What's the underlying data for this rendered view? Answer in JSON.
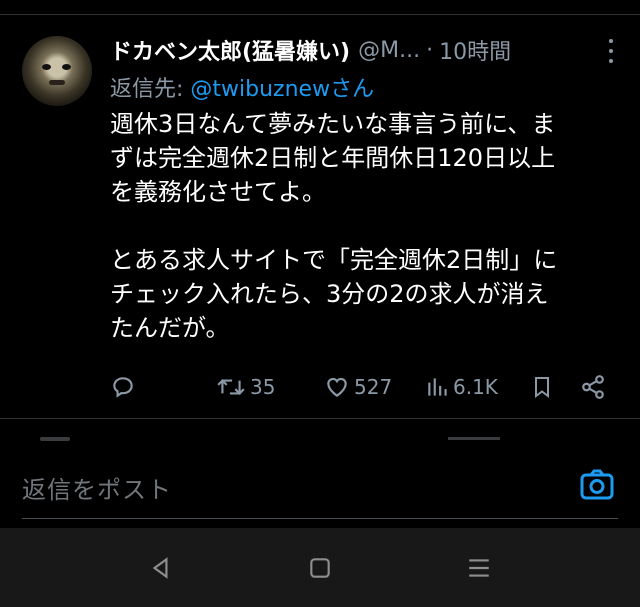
{
  "tweet": {
    "author_name": "ドカベン太郎(猛暑嫌い)",
    "author_handle": "@M...",
    "separator": "·",
    "time": "10時間",
    "reply_prefix": "返信先: ",
    "reply_mention": "@twibuznewさん",
    "body_lines": [
      "週休3日なんて夢みたいな事言う前に、ま",
      "ずは完全週休2日制と年間休日120日以上",
      "を義務化させてよ。",
      "",
      "とある求人サイトで「完全週休2日制」に",
      "チェック入れたら、3分の2の求人が消え",
      "たんだが。"
    ],
    "stats": {
      "retweets": "35",
      "likes": "527",
      "views": "6.1K"
    }
  },
  "composer": {
    "placeholder": "返信をポスト"
  },
  "colors": {
    "background": "#000000",
    "text": "#e7e9ea",
    "muted": "#8b98a5",
    "accent": "#1d9bf0",
    "navbar": "#181818"
  },
  "icons": [
    "more-icon",
    "reply-icon",
    "retweet-icon",
    "like-icon",
    "views-icon",
    "bookmark-icon",
    "share-icon",
    "camera-icon",
    "back-icon",
    "home-icon",
    "recents-icon"
  ]
}
